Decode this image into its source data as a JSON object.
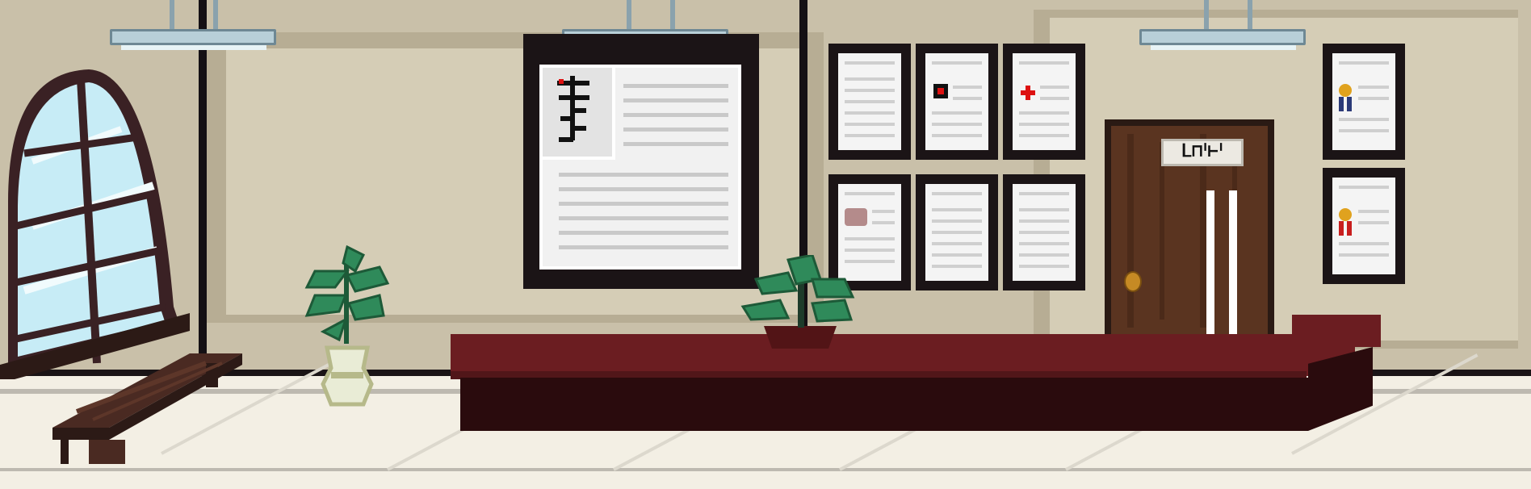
{
  "scene": {
    "description_hidden": "",
    "door_sign_text": "ᒪ⊓ᑊ⊢ᑊ",
    "colors": {
      "wall": "#c9c0a9",
      "floor": "#f3efe4",
      "counter": "#6b1d21",
      "door": "#5a3420",
      "plant": "#2f8a5a",
      "window_glass": "#c7ecf6"
    },
    "icons": {
      "notice_glyph": "glyph-icon",
      "red_square": "red-square-icon",
      "red_cross": "red-cross-icon",
      "medal_blue": "medal-icon",
      "medal_red": "medal-icon",
      "pink_blob": "stain-icon"
    }
  }
}
